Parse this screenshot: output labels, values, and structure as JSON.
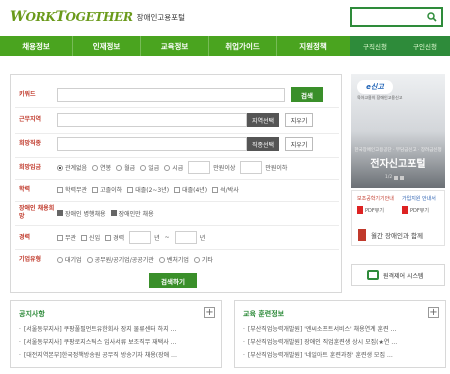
{
  "header": {
    "logo_part1": "W",
    "logo_part2": "ORK",
    "logo_part3": "T",
    "logo_part4": "OGETHER",
    "logo_subtitle": "장애인고용포털",
    "search_placeholder": ""
  },
  "nav": {
    "items": [
      "채용정보",
      "인재정보",
      "교육정보",
      "취업가이드",
      "지원정책"
    ],
    "right": [
      "구직신청",
      "구인신청"
    ]
  },
  "form": {
    "keyword_label": "키워드",
    "keyword_value": "",
    "search_btn": "검색",
    "region_label": "근무지역",
    "region_select": "지역선택",
    "region_clear": "지우기",
    "job_label": "희망직종",
    "job_select": "직종선택",
    "job_clear": "지우기",
    "wage_label": "희망임금",
    "wage_options": [
      "관계없음",
      "연봉",
      "월급",
      "일급",
      "시급"
    ],
    "wage_selected": "관계없음",
    "wage_unit_min": "만원이상",
    "wage_unit_max": "만원이하",
    "edu_label": "학력",
    "edu_options": [
      "학력무관",
      "고졸이하",
      "대졸(2~3년)",
      "대졸(4년)",
      "석/박사"
    ],
    "disabled_label": "장애인 채용희망",
    "disabled_options": [
      "장애인 병행채용",
      "장애인만 채용"
    ],
    "disabled_checked": [
      "장애인 병행채용",
      "장애인만 채용"
    ],
    "career_label": "경력",
    "career_options": [
      "무관",
      "신입",
      "경력"
    ],
    "career_year1": "년",
    "career_tilde": "~",
    "career_year2": "년",
    "company_label": "기업유형",
    "company_options": [
      "대기업",
      "공무원/공기업/공공기관",
      "벤처기업",
      "기타"
    ],
    "submit_btn": "검색하기"
  },
  "banner": {
    "tag": "e신고",
    "tag_sub": "육아고용이 장애인고용신고",
    "subtitle": "한국장애인고용공단 · 부담금신고 · 장려금신청",
    "title": "전자신고포털",
    "page": "1/2"
  },
  "guides": {
    "left_title": "보조공학기기안내",
    "left_pdf": "PDF뷰기",
    "right_title": "가입지원 안내서",
    "right_pdf": "PDF뷰기",
    "news_text": "월간 장애인과 함께"
  },
  "remote": {
    "label": "원격제어 시스템"
  },
  "notice": {
    "title": "공지사항",
    "items": [
      "[서울동부지사] 쿠팡풀필먼트유한회사 장지 물류센터 하지 …",
      "[서울동부지사] 쿠팡로지스틱스 입사서류 보조직무 재택사 …",
      "[대전지역본부]한국정책방송원 공무직 방송기자 채용(장애 …"
    ]
  },
  "training": {
    "title": "교육 훈련정보",
    "items": [
      "[부산직업능력개발원] '엔씨소프트서비스' 채용연계 훈련 …",
      "[부산직업능력개발원] 장애인 직업훈련생 상시 모집(★연 …",
      "[부산직업능력개발원] '네일아트 훈련과정' 훈련생 모집 …"
    ]
  },
  "colors": {
    "primary_green": "#4aa41f",
    "dark_green": "#2e8b3a",
    "label_red": "#c0392b"
  }
}
